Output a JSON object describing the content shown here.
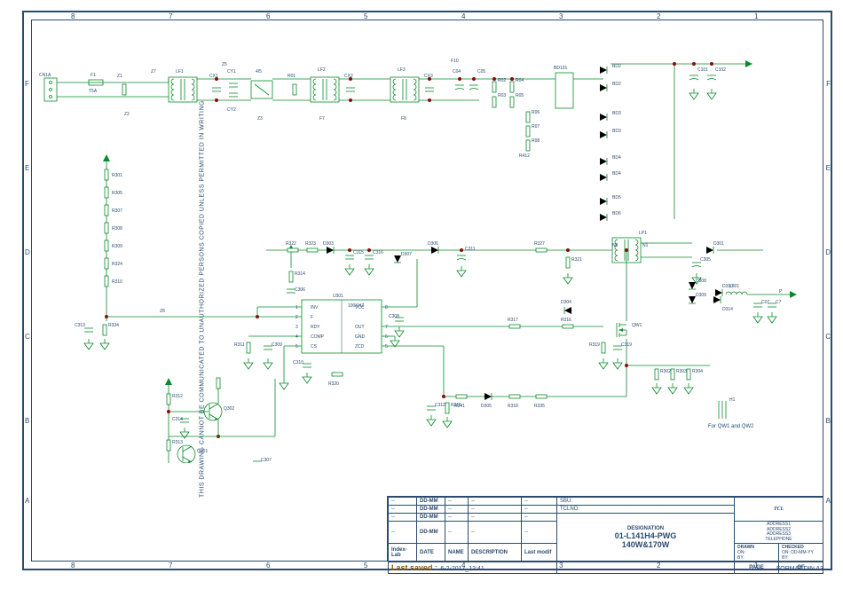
{
  "sidebar_text": "THIS DRAWING CANNOT BE COMMUNICATED TO UNAUTHORIZED PERSONS COPIED UNLESS PERMITTED IN WRITING",
  "format_label": "FORMAT DIN A3",
  "grid_cols": [
    "8",
    "7",
    "6",
    "5",
    "4",
    "3",
    "2",
    "1"
  ],
  "grid_rows": [
    "F",
    "E",
    "D",
    "C",
    "B",
    "A"
  ],
  "footer_note": "For QW1 and QW2",
  "titleblock": {
    "row_hdr": [
      "--",
      "DD-MM",
      "--",
      "--",
      "--",
      "SBU:"
    ],
    "row2": [
      "--",
      "DD-MM",
      "--",
      "--",
      "--",
      "TCLNO:"
    ],
    "row3": [
      "--",
      "DD-MM",
      "--",
      "--",
      "--"
    ],
    "row4": [
      "--",
      "DD-MM",
      "--",
      "--",
      "--"
    ],
    "idx": [
      "Index-Lab",
      "DATE",
      "NAME",
      "DESCRIPTION",
      "Last modif"
    ],
    "saved_lab": "Last saved :",
    "saved_val": "6-2-2017_12:41",
    "desig_hdr": "DESIGNATION",
    "desig1": "01-L141H4-PWG",
    "desig2": "140W&170W",
    "brand": "TCL",
    "addr": [
      "ADDRESS1",
      "ADDRESS2",
      "ADDRESS3",
      "TELEPHONE"
    ],
    "drawn": "DRAWN",
    "checked": "CHECKED",
    "on": "ON:",
    "by": "BY:",
    "date_fmt": "DD-MM-YY",
    "page": "PAGE",
    "of": "OF"
  },
  "ic": {
    "ref": "U301",
    "freq": "100KHZ",
    "pins": {
      "p1": "INV",
      "p8": "VCC",
      "p2": "F",
      "p7": "",
      "p3": "RDY",
      "p_out": "OUT",
      "p4": "COMP",
      "p6": "GND",
      "p5": "CS",
      "p_zcd": "ZCD"
    },
    "nums": [
      "1",
      "2",
      "3",
      "4",
      "5",
      "6",
      "7",
      "8"
    ]
  },
  "components": {
    "cn1a": "CN1A",
    "f1": "F1",
    "z1": "Z1",
    "z2": "Z2",
    "z3": "Z3",
    "z5": "Z5",
    "z7": "Z7",
    "z8": "Z8",
    "lf1": "LF1",
    "lf2": "LF2",
    "lf3": "LF3",
    "lp1": "LP1",
    "l301": "L301",
    "cx1": "CX1",
    "cx2": "CX2",
    "cx3": "CX3",
    "cy1": "CY1",
    "cy2": "CY2",
    "bd101": "BD101",
    "bd2": "BD2",
    "bd3": "BD3",
    "bd4": "BD4",
    "bd5": "BD5",
    "bd6": "BD6",
    "r01": "R01",
    "r02": "R02",
    "r03": "R03",
    "r04": "R04",
    "r05": "R05",
    "r06": "R06",
    "r07": "R07",
    "r08": "R08",
    "r301": "R301",
    "r302": "R302",
    "r303": "R303",
    "r304": "R304",
    "r305": "R305",
    "r307": "R307",
    "r308": "R308",
    "r309": "R309",
    "r310": "R310",
    "r311": "R311",
    "r312": "R312",
    "r313": "R313",
    "r314": "R314",
    "r315": "R315",
    "r316": "R316",
    "r317": "R317",
    "r318": "R318",
    "r319": "R319",
    "r320": "R320",
    "r321": "R321",
    "r322": "R322",
    "r323": "R323",
    "r324": "R324",
    "r327": "R327",
    "r334": "R334",
    "r335": "R335",
    "r341": "R341",
    "r412": "R412",
    "c04": "C04",
    "c05": "C05",
    "c101": "C101",
    "c102": "C102",
    "c305": "C305",
    "c306": "C306",
    "c307": "C307",
    "c308": "C308",
    "c309": "C309",
    "c310": "C310",
    "c311": "C311",
    "c312": "C312",
    "c313": "C313",
    "c314": "C314",
    "c315": "C315",
    "c316": "C316",
    "c319": "C319",
    "d301": "D301",
    "d303": "D303",
    "d304": "D304",
    "d305": "D305",
    "d306": "D306",
    "d307": "D307",
    "d308": "D308",
    "d309": "D309",
    "d310": "D310",
    "d314": "D314",
    "q301": "Q301",
    "q302": "Q302",
    "qw1": "QW1",
    "f7": "F7",
    "f8": "F8",
    "f10": "F10",
    "n1": "N1",
    "n2": "N2",
    "h1": "H1",
    "fuse1": "T5A"
  }
}
